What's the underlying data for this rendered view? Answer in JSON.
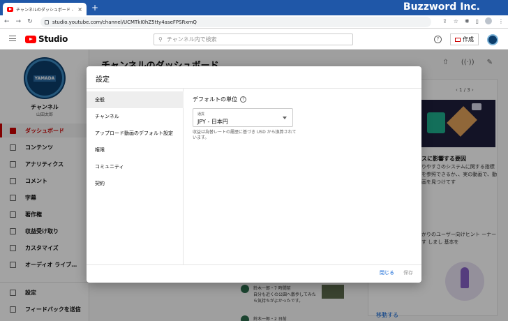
{
  "browser": {
    "tab_title": "チャンネルのダッシュボード - YouTube",
    "watermark": "Buzzword Inc.",
    "url": "studio.youtube.com/channel/UCMTkI0hZ5tty4aseFPSRxmQ"
  },
  "header": {
    "logo_text": "Studio",
    "search_placeholder": "チャンネル内で検索",
    "create_label": "作成"
  },
  "sidebar": {
    "avatar_text": "YAMADA",
    "channel_title": "チャンネル",
    "channel_sub": "山田太郎",
    "items": [
      {
        "label": "ダッシュボード"
      },
      {
        "label": "コンテンツ"
      },
      {
        "label": "アナリティクス"
      },
      {
        "label": "コメント"
      },
      {
        "label": "字幕"
      },
      {
        "label": "著作権"
      },
      {
        "label": "収益受け取り"
      },
      {
        "label": "カスタマイズ"
      },
      {
        "label": "オーディオ ライブ…"
      }
    ],
    "bottom_items": [
      {
        "label": "設定"
      },
      {
        "label": "フィードバックを送信"
      }
    ]
  },
  "main": {
    "title": "チャンネルのダッシュボード",
    "card_page": "1 / 3",
    "card_heading": "スに影響する要因",
    "card_body": "りやすさのシステムに関する指標を参照できるか、、実の動画で、動画を見つけてす",
    "card2_body": "かりのユーザー向けヒント ーナーす しまし 基本を",
    "move_label": "移動する",
    "video_rows": [
      {
        "meta": "鈴木一郎・7 時間前",
        "text": "自分も近くの公園へ散歩してみたら気持ちがよかったです。"
      },
      {
        "meta": "鈴木一郎・2 日前",
        "text": ""
      }
    ]
  },
  "modal": {
    "title": "設定",
    "nav": [
      {
        "label": "全般"
      },
      {
        "label": "チャンネル"
      },
      {
        "label": "アップロード動画のデフォルト設定"
      },
      {
        "label": "権限"
      },
      {
        "label": "コミュニティ"
      },
      {
        "label": "契約"
      }
    ],
    "section_label": "デフォルトの単位",
    "currency_caption": "通貨",
    "currency_value": "JPY - 日本円",
    "note": "収益は為替レートの履歴に基づき USD から換算されています。",
    "close_label": "閉じる",
    "save_label": "保存"
  }
}
